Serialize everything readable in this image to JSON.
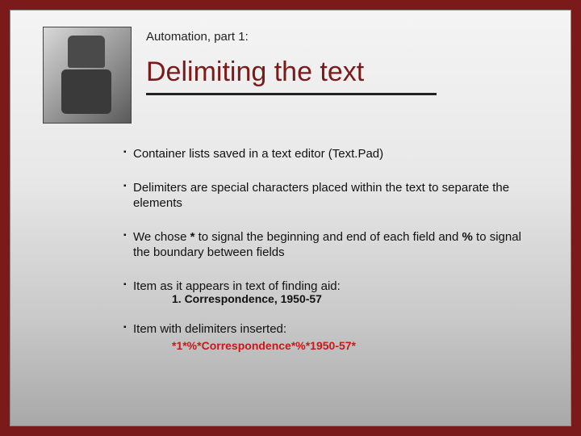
{
  "header": {
    "subtitle": "Automation, part 1:",
    "title": "Delimiting the text"
  },
  "bullets": {
    "b1": "Container lists saved in a text editor (Text.Pad)",
    "b2": "Delimiters are special characters placed within the text to separate the elements",
    "b3_pre": "We chose ",
    "b3_star": "*",
    "b3_mid": " to signal the beginning and end of each field and ",
    "b3_pct": "%",
    "b3_post": " to signal the boundary between fields",
    "b4": "Item as it appears in text of finding aid:",
    "b5": "Item with delimiters inserted:"
  },
  "examples": {
    "plain": "1. Correspondence, 1950-57",
    "delimited": "*1*%*Correspondence*%*1950-57*"
  }
}
